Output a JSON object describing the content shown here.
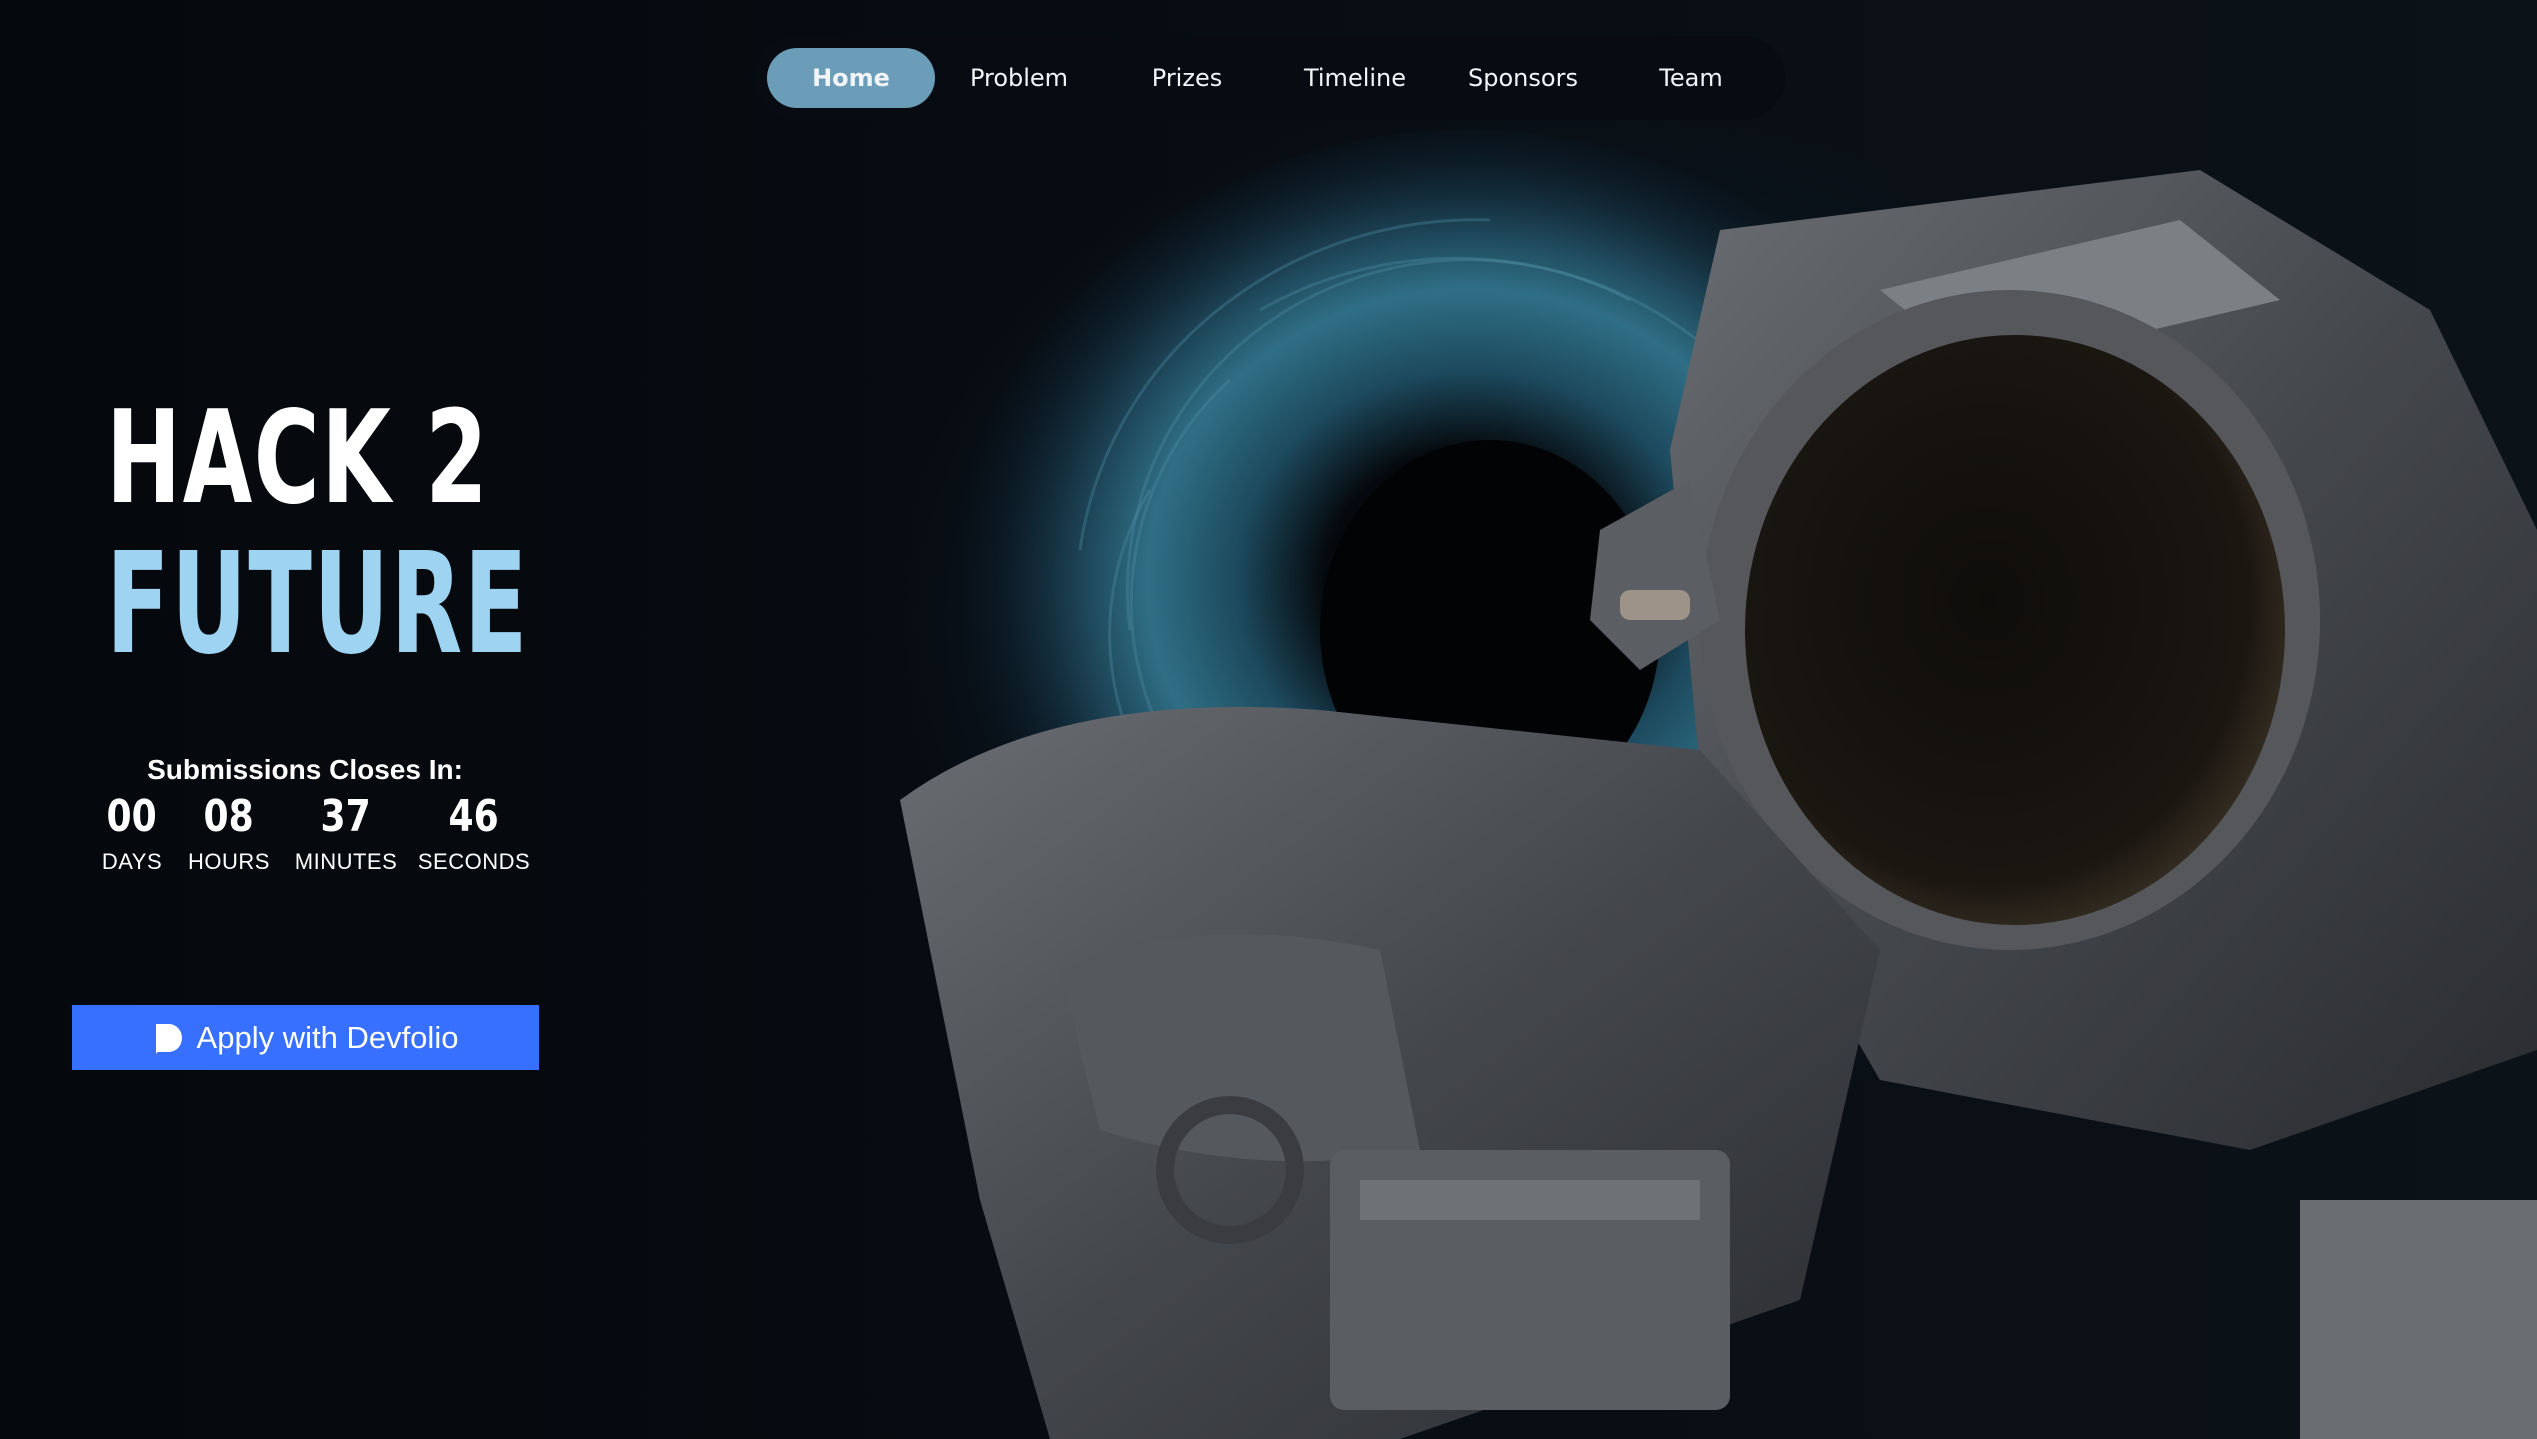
{
  "nav": {
    "items": [
      {
        "label": "Home",
        "active": true
      },
      {
        "label": "Problem",
        "active": false
      },
      {
        "label": "Prizes",
        "active": false
      },
      {
        "label": "Timeline",
        "active": false
      },
      {
        "label": "Sponsors",
        "active": false
      },
      {
        "label": "Team",
        "active": false
      }
    ]
  },
  "hero": {
    "title_line1": "HACK 2",
    "title_line2": "FUTURE"
  },
  "countdown": {
    "label": "Submissions Closes In:",
    "units": [
      {
        "value": "00",
        "label": "DAYS"
      },
      {
        "value": "08",
        "label": "HOURS"
      },
      {
        "value": "37",
        "label": "MINUTES"
      },
      {
        "value": "46",
        "label": "SECONDS"
      }
    ]
  },
  "apply_button": {
    "label": "Apply with Devfolio",
    "icon": "devfolio-icon"
  },
  "colors": {
    "accent": "#6b9cb8",
    "title_highlight": "#9ed4f2",
    "button": "#3770ff"
  }
}
